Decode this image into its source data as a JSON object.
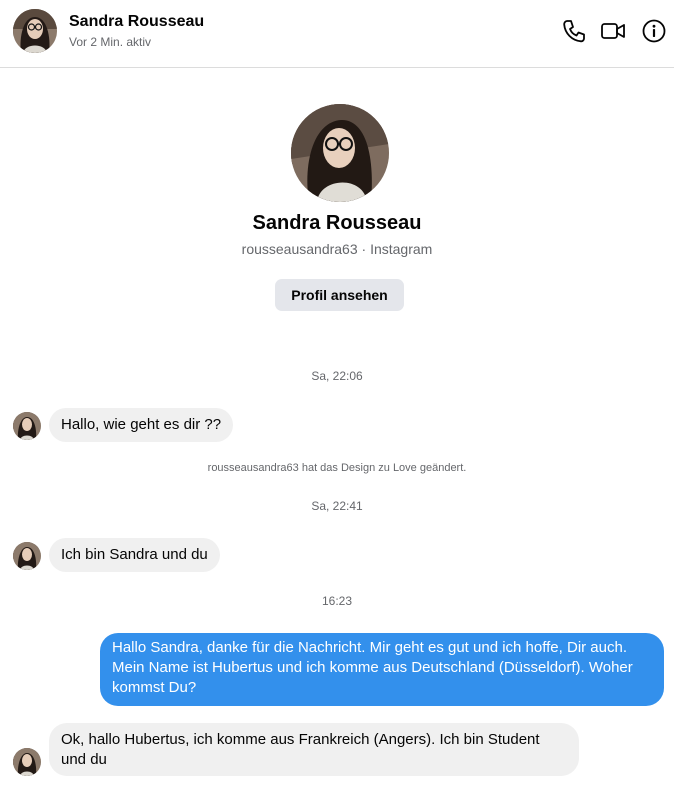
{
  "header": {
    "name": "Sandra Rousseau",
    "status": "Vor 2 Min. aktiv",
    "icons": [
      "phone-icon",
      "video-call-icon",
      "info-icon"
    ]
  },
  "profile": {
    "name": "Sandra Rousseau",
    "subtitle": "rousseausandra63 · Instagram",
    "button_label": "Profil ansehen"
  },
  "conversation": {
    "time_1": "Sa, 22:06",
    "msg_1": "Hallo, wie geht es dir ??",
    "notice_1": "rousseausandra63 hat das Design zu Love geändert.",
    "time_2": "Sa, 22:41",
    "msg_2": "Ich bin Sandra und du",
    "time_3": "16:23",
    "msg_3": "Hallo Sandra, danke für die Nachricht. Mir geht es gut und ich hoffe, Dir auch. Mein Name ist Hubertus und ich komme aus Deutschland (Düsseldorf). Woher kommst Du?",
    "msg_4": "Ok, hallo Hubertus, ich komme aus Frankreich (Angers). Ich bin Student und du"
  },
  "colors": {
    "outgoing_bubble": "#3390ec",
    "incoming_bubble": "#f0f0f0",
    "secondary_text": "#65676b"
  }
}
